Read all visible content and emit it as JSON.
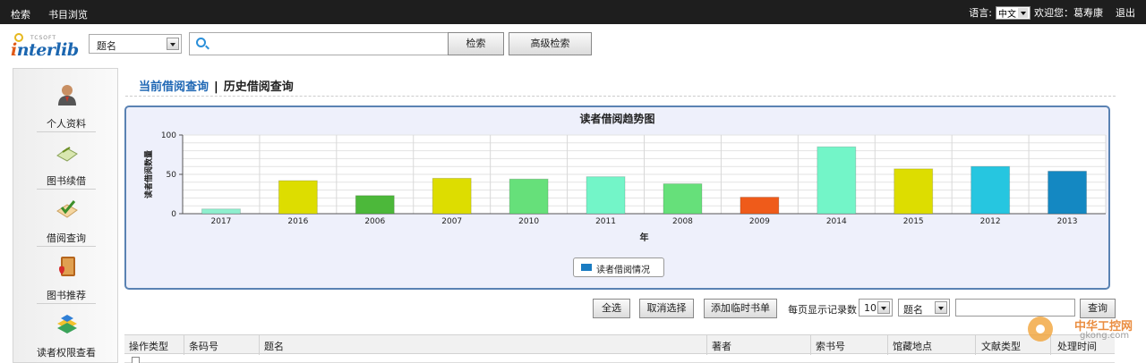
{
  "topbar": {
    "nav": [
      "检索",
      "书目浏览"
    ],
    "language_label": "语言:",
    "language_value": "中文",
    "welcome": "欢迎您：葛寿康",
    "logout": "退出"
  },
  "header": {
    "logo_text_i": "i",
    "logo_text_rest": "nterlib",
    "logo_small": "TCSOFT",
    "search_type": "题名",
    "search_value": "",
    "search_button": "检索",
    "advanced_button": "高级检索"
  },
  "sidebar": {
    "items": [
      {
        "label": "个人资料",
        "icon": "user-icon"
      },
      {
        "label": "图书续借",
        "icon": "renew-icon"
      },
      {
        "label": "借阅查询",
        "icon": "check-icon"
      },
      {
        "label": "图书推荐",
        "icon": "recommend-icon"
      },
      {
        "label": "读者权限查看",
        "icon": "permission-icon"
      }
    ]
  },
  "tabs": {
    "current": "当前借阅查询",
    "separator": "|",
    "history": "历史借阅查询"
  },
  "chart_data": {
    "type": "bar",
    "title": "读者借阅趋势图",
    "xlabel": "年",
    "ylabel": "读者借阅数量",
    "ylim": [
      0,
      100
    ],
    "yticks": [
      0,
      50,
      100
    ],
    "categories": [
      "2017",
      "2016",
      "2006",
      "2007",
      "2010",
      "2011",
      "2008",
      "2009",
      "2014",
      "2015",
      "2012",
      "2013"
    ],
    "series": [
      {
        "name": "读者借阅情况",
        "values": [
          6,
          42,
          23,
          45,
          44,
          47,
          38,
          21,
          85,
          57,
          60,
          54
        ]
      }
    ],
    "colors": [
      "#8ff0cf",
      "#dddd00",
      "#4cb83a",
      "#dddd00",
      "#66e07a",
      "#73f5c8",
      "#66e07a",
      "#ef5b1a",
      "#73f5c8",
      "#dddd00",
      "#26c6e0",
      "#1488c2"
    ],
    "grid": true,
    "legend_position": "bottom-center"
  },
  "toolbar": {
    "select_all": "全选",
    "cancel_select": "取消选择",
    "add_temp_list": "添加临时书单",
    "per_page_label": "每页显示记录数",
    "per_page_value": "10",
    "field_value": "题名",
    "query_value": "",
    "query_button": "查询"
  },
  "table": {
    "headers": [
      "操作类型",
      "条码号",
      "题名",
      "著者",
      "索书号",
      "馆藏地点",
      "文献类型",
      "处理时间"
    ]
  },
  "watermark": {
    "title": "中华工控网",
    "domain": "gkong.com"
  }
}
